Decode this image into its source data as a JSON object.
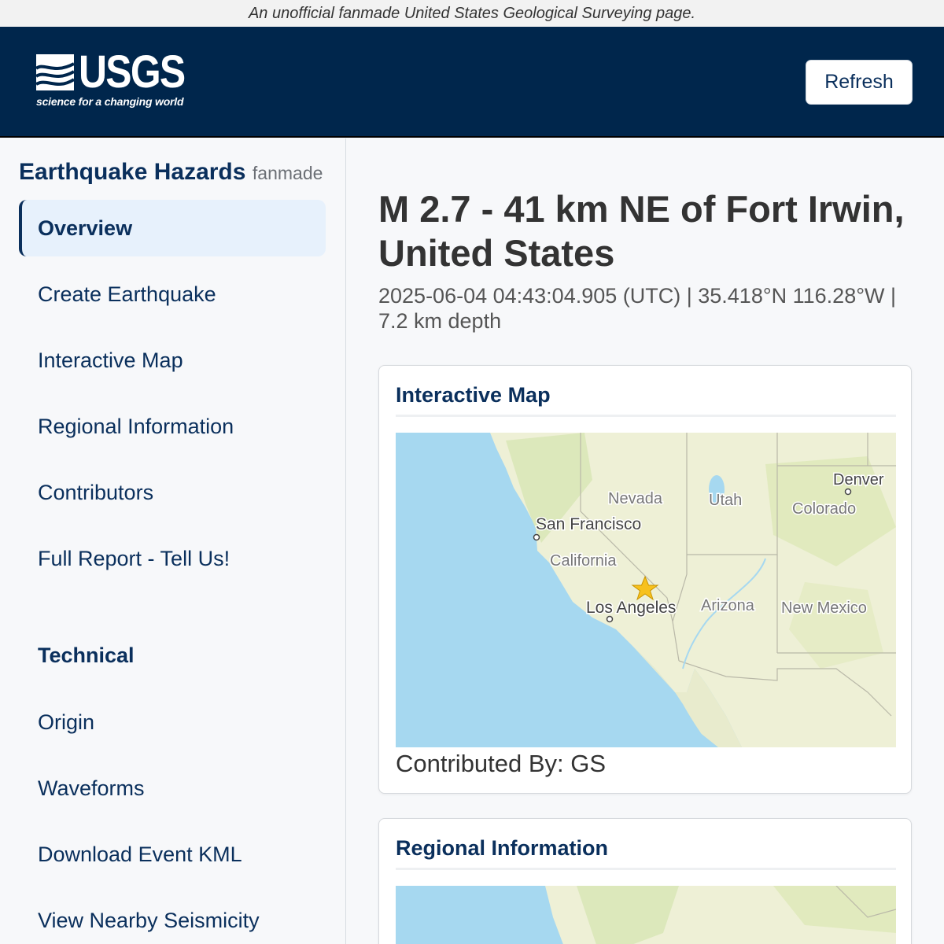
{
  "disclaimer": "An unofficial fanmade United States Geological Surveying page.",
  "header": {
    "logo_text": "USGS",
    "logo_tagline": "science for a changing world",
    "refresh_label": "Refresh"
  },
  "sidebar": {
    "app_title": "Earthquake Hazards",
    "app_subtitle": "fanmade",
    "nav_items": [
      {
        "label": "Overview",
        "active": true
      },
      {
        "label": "Create Earthquake"
      },
      {
        "label": "Interactive Map"
      },
      {
        "label": "Regional Information"
      },
      {
        "label": "Contributors"
      },
      {
        "label": "Full Report - Tell Us!"
      }
    ],
    "technical_heading": "Technical",
    "technical_items": [
      {
        "label": "Origin"
      },
      {
        "label": "Waveforms"
      },
      {
        "label": "Download Event KML"
      },
      {
        "label": "View Nearby Seismicity"
      }
    ]
  },
  "event": {
    "title": "M 2.7 - 41 km NE of Fort Irwin, United States",
    "meta": "2025-06-04 04:43:04.905 (UTC) | 35.418°N 116.28°W | 7.2 km depth"
  },
  "cards": {
    "interactive_map": {
      "title": "Interactive Map",
      "contributed_by": "Contributed By: GS",
      "labels": {
        "nevada": "Nevada",
        "utah": "Utah",
        "denver": "Denver",
        "colorado": "Colorado",
        "san_francisco": "San Francisco",
        "california": "California",
        "los_angeles": "Los Angeles",
        "arizona": "Arizona",
        "new_mexico": "New Mexico"
      }
    },
    "regional_information": {
      "title": "Regional Information"
    }
  },
  "colors": {
    "header_bg": "#00264c",
    "nav_text": "#0a2f5c",
    "active_bg": "#e7f1fc",
    "ocean": "#a6d8f0",
    "land": "#eef0d6",
    "epicenter": "#f7c11d"
  }
}
